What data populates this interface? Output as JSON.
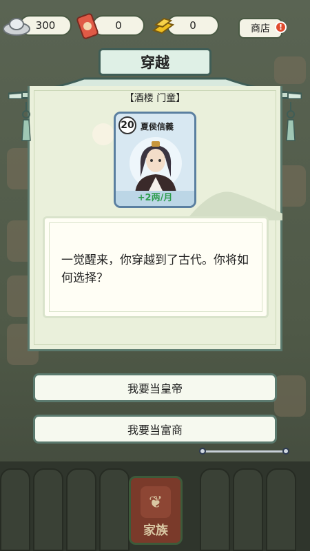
{
  "resources": {
    "silver": "300",
    "token": "0",
    "gold": "0"
  },
  "shop": {
    "label": "商店",
    "badge": "!"
  },
  "dialog": {
    "title": "穿越",
    "location": "【酒楼 门童】",
    "character": {
      "level": "20",
      "name": "夏侯信義",
      "income": "+2两/月"
    },
    "story": "一觉醒来，你穿越到了古代。你将如何选择？",
    "choices": [
      {
        "label": "我要当皇帝"
      },
      {
        "label": "我要当富商"
      }
    ]
  },
  "bottom": {
    "family_label": "家族"
  },
  "colors": {
    "accent_green": "#5b7a6e",
    "income_green": "#2e9d4e",
    "badge_red": "#e04a2e"
  }
}
